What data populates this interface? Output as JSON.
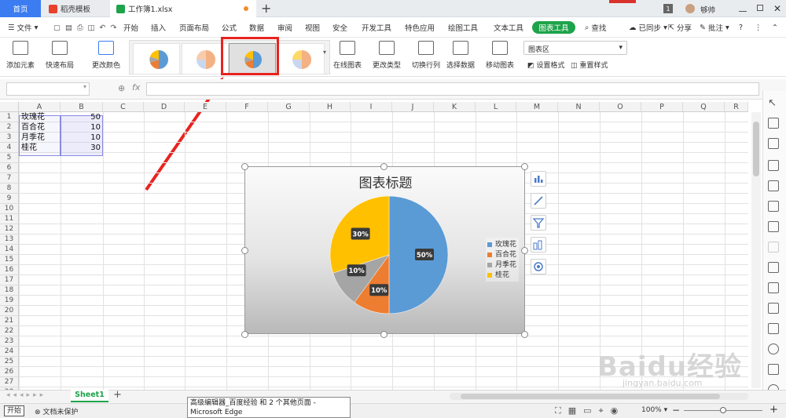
{
  "tabs": {
    "home": "首页",
    "template": "稻壳模板",
    "file": "工作簿1.xlsx",
    "new_tab": "+"
  },
  "titlebar": {
    "badge": "1",
    "user": "够帅"
  },
  "menu": {
    "file": "文件",
    "items": [
      "开始",
      "插入",
      "页面布局",
      "公式",
      "数据",
      "审阅",
      "视图",
      "安全",
      "开发工具",
      "特色应用",
      "绘图工具",
      "文本工具"
    ],
    "chart_tools": "图表工具",
    "search": "查找",
    "sync": "已同步",
    "share": "分享",
    "comment": "批注",
    "help": "?"
  },
  "ribbon": {
    "add_element": "添加元素",
    "quick_layout": "快速布局",
    "change_color": "更改颜色",
    "online_chart": "在线图表",
    "change_type": "更改类型",
    "switch_rowcol": "切换行列",
    "select_data": "选择数据",
    "move_chart": "移动图表",
    "chart_area": "图表区",
    "set_format": "设置格式",
    "reset_style": "重置样式"
  },
  "formula": {
    "fx": "fx",
    "value": ""
  },
  "columns": [
    "A",
    "B",
    "C",
    "D",
    "E",
    "F",
    "G",
    "H",
    "I",
    "J",
    "K",
    "L",
    "M",
    "N",
    "O",
    "P",
    "Q",
    "R"
  ],
  "rows": [
    "1",
    "2",
    "3",
    "4",
    "5",
    "6",
    "7",
    "8",
    "9",
    "10",
    "11",
    "12",
    "13",
    "14",
    "15",
    "16",
    "17",
    "18",
    "19",
    "20",
    "21",
    "22",
    "23",
    "24",
    "25",
    "26",
    "27",
    "28"
  ],
  "cells": [
    [
      "玫瑰花",
      "50"
    ],
    [
      "百合花",
      "10"
    ],
    [
      "月季花",
      "10"
    ],
    [
      "桂花",
      "30"
    ]
  ],
  "chart_data": {
    "type": "pie",
    "title": "图表标题",
    "categories": [
      "玫瑰花",
      "百合花",
      "月季花",
      "桂花"
    ],
    "values": [
      50,
      10,
      10,
      30
    ],
    "labels": [
      "50%",
      "10%",
      "10%",
      "30%"
    ],
    "colors": [
      "#5b9bd5",
      "#ed7d31",
      "#a5a5a5",
      "#ffc000"
    ],
    "legend": "right"
  },
  "sheet": {
    "name": "Sheet1",
    "add": "+"
  },
  "status": {
    "start": "开始",
    "protect": "文档未保护",
    "zoom": "100%"
  },
  "tooltip": {
    "text": "高级编辑器_百度经验 和 2 个其他页面 - Microsoft Edge"
  },
  "watermark": {
    "main": "Baidu经验",
    "sub": "jingyan.baidu.com"
  }
}
